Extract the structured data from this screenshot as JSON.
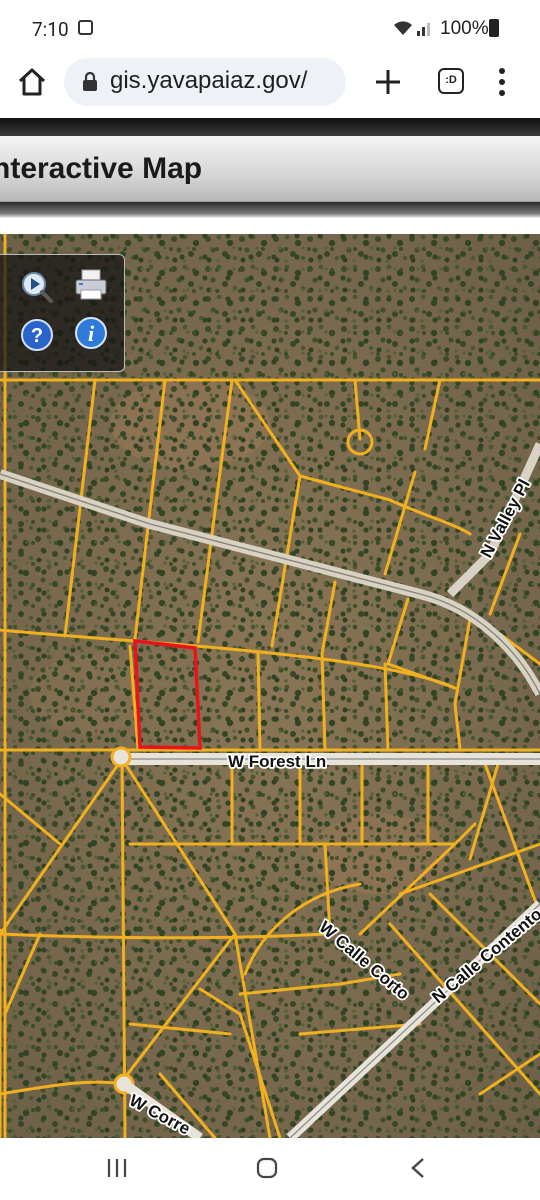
{
  "status": {
    "time": "7:10",
    "battery": "100%"
  },
  "browser": {
    "url": "gis.yavapaiaz.gov/",
    "tabs_count_label": ":D"
  },
  "page": {
    "title": "nteractive Map"
  },
  "map": {
    "road_labels": {
      "forest": "W Forest Ln",
      "valley": "N Valley Pl",
      "calle_corto": "W Calle Corto",
      "calle_contento": "N Calle Contento",
      "correo": "W Corre"
    },
    "colors": {
      "parcel_lines": "#f0b020",
      "selected_parcel": "#e8141c",
      "road_fill": "#e8e3d8"
    }
  },
  "toolbox": {
    "items": [
      "zoom-icon",
      "print-icon",
      "help-icon",
      "info-icon"
    ]
  },
  "navbar": {
    "items": [
      "recents-icon",
      "home-icon",
      "back-icon"
    ]
  }
}
